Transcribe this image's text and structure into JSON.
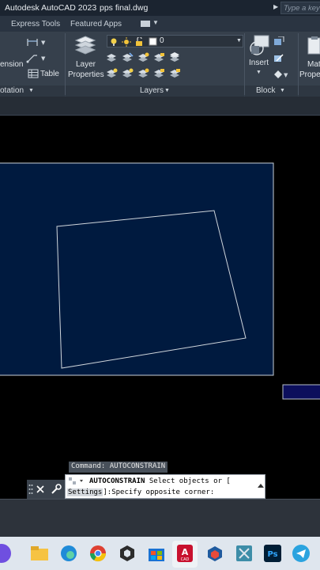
{
  "title_bar": {
    "app_name": "Autodesk AutoCAD 2023",
    "file_name": "pps final.dwg",
    "search_placeholder": "Type a keyword"
  },
  "ribbon_tabs": [
    "Express Tools",
    "Featured Apps"
  ],
  "ribbon": {
    "annotation_panel": {
      "dimension_label": "ension",
      "table_label": "Table",
      "footer": "otation"
    },
    "layers_panel": {
      "layer_properties_line1": "Layer",
      "layer_properties_line2": "Properties",
      "current_layer": "0",
      "footer": "Layers"
    },
    "block_panel": {
      "insert_label": "Insert",
      "footer": "Block"
    },
    "match_panel": {
      "line1": "Mat",
      "line2": "Prope"
    }
  },
  "command_line": {
    "history": "Command: AUTOCONSTRAIN",
    "command_name": "AUTOCONSTRAIN",
    "prompt_part1": " Select objects or [",
    "option": "Settings",
    "prompt_part2": "]:Specify opposite corner:"
  },
  "colors": {
    "drawing_background": "#001a3f",
    "selection_window": "#0c0f5c",
    "title_bar": "#1b2430",
    "ribbon": "#36404c"
  }
}
